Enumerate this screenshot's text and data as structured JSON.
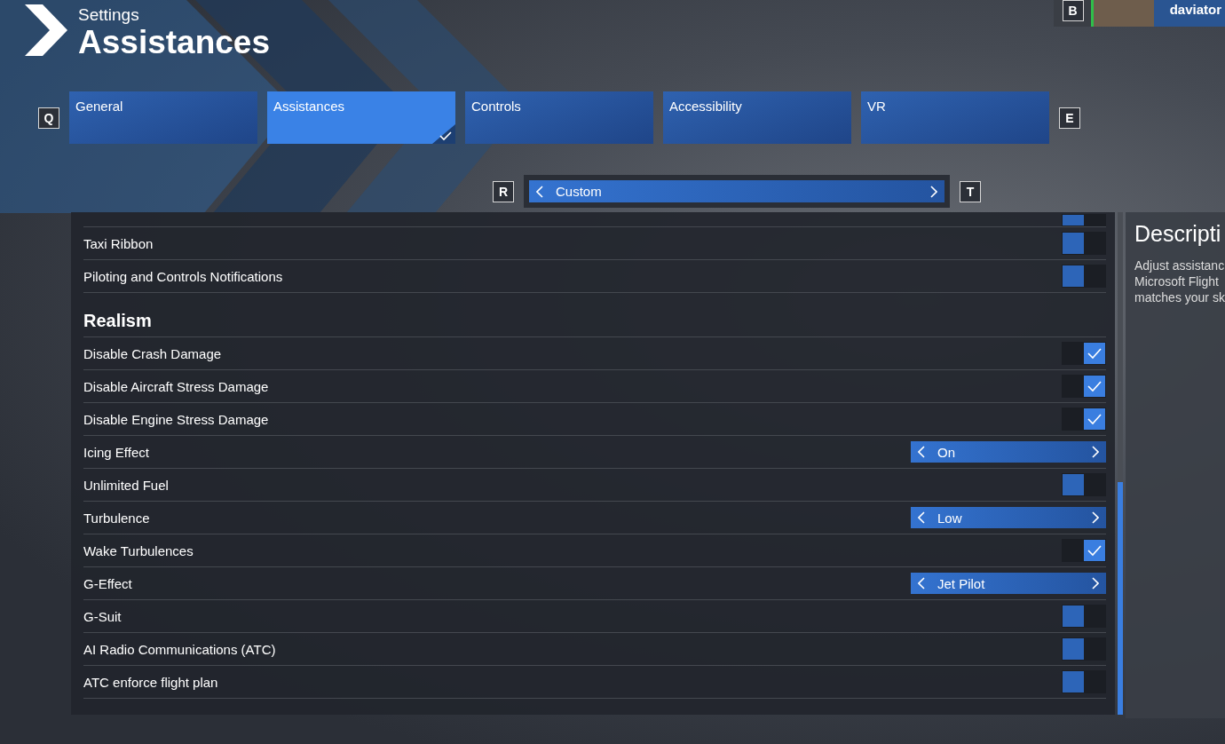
{
  "header": {
    "subtitle": "Settings",
    "title": "Assistances"
  },
  "profile": {
    "key": "B",
    "username": "daviator"
  },
  "tabs_keys": {
    "prev": "Q",
    "next": "E"
  },
  "tabs": [
    {
      "label": "General",
      "selected": false
    },
    {
      "label": "Assistances",
      "selected": true
    },
    {
      "label": "Controls",
      "selected": false
    },
    {
      "label": "Accessibility",
      "selected": false
    },
    {
      "label": "VR",
      "selected": false
    }
  ],
  "preset": {
    "prev_key": "R",
    "next_key": "T",
    "value": "Custom"
  },
  "settings": [
    {
      "kind": "toggle",
      "on": false
    },
    {
      "kind": "toggle",
      "label": "Taxi Ribbon",
      "on": false
    },
    {
      "kind": "toggle",
      "label": "Piloting and Controls Notifications",
      "on": false
    },
    {
      "kind": "heading",
      "label": "Realism"
    },
    {
      "kind": "toggle",
      "label": "Disable Crash Damage",
      "on": true
    },
    {
      "kind": "toggle",
      "label": "Disable Aircraft Stress Damage",
      "on": true
    },
    {
      "kind": "toggle",
      "label": "Disable Engine Stress Damage",
      "on": true
    },
    {
      "kind": "select",
      "label": "Icing Effect",
      "value": "On"
    },
    {
      "kind": "toggle",
      "label": "Unlimited Fuel",
      "on": false
    },
    {
      "kind": "select",
      "label": "Turbulence",
      "value": "Low"
    },
    {
      "kind": "toggle",
      "label": "Wake Turbulences",
      "on": true
    },
    {
      "kind": "select",
      "label": "G-Effect",
      "value": "Jet Pilot"
    },
    {
      "kind": "toggle",
      "label": "G-Suit",
      "on": false
    },
    {
      "kind": "toggle",
      "label": "AI Radio Communications (ATC)",
      "on": false
    },
    {
      "kind": "toggle",
      "label": "ATC enforce flight plan",
      "on": false
    }
  ],
  "description": {
    "title": "Descripti",
    "lines": [
      "Adjust assistanc",
      "Microsoft Flight",
      "matches your sk"
    ]
  }
}
